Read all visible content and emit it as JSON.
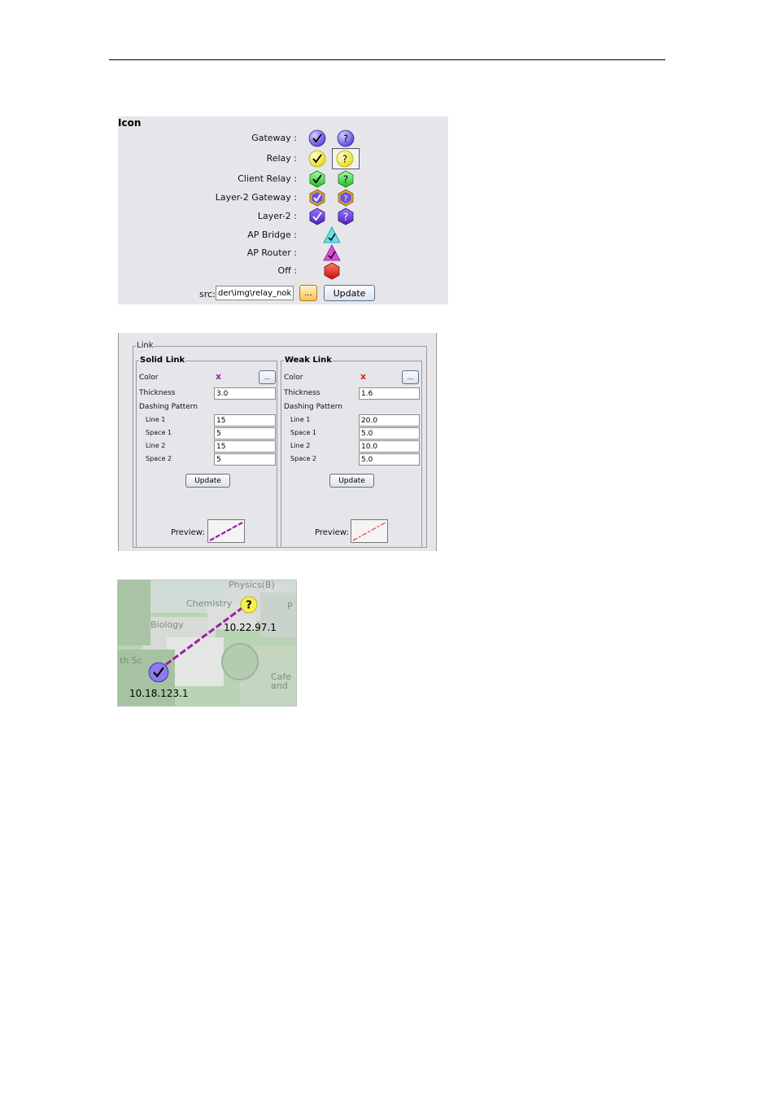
{
  "icon_panel": {
    "title": "Icon",
    "rows": [
      {
        "label": "Gateway :"
      },
      {
        "label": "Relay :"
      },
      {
        "label": "Client Relay :"
      },
      {
        "label": "Layer-2 Gateway :"
      },
      {
        "label": "Layer-2 :"
      },
      {
        "label": "AP Bridge :"
      },
      {
        "label": "AP Router :"
      },
      {
        "label": "Off :"
      }
    ],
    "src_label": "src:",
    "src_value": "der\\img\\relay_nok.gif",
    "browse_label": "...",
    "update_label": "Update"
  },
  "link_panel": {
    "title": "Link",
    "solid": {
      "title": "Solid Link",
      "color_label": "Color",
      "color_mark": "x",
      "color_value": "#9b1fa5",
      "browse_label": "...",
      "thickness_label": "Thickness",
      "thickness": "3.0",
      "dashing_label": "Dashing Pattern",
      "line1_label": "Line 1",
      "line1": "15",
      "space1_label": "Space 1",
      "space1": "5",
      "line2_label": "Line 2",
      "line2": "15",
      "space2_label": "Space 2",
      "space2": "5",
      "update_label": "Update",
      "preview_label": "Preview:"
    },
    "weak": {
      "title": "Weak Link",
      "color_label": "Color",
      "color_mark": "x",
      "color_value": "#e0201a",
      "browse_label": "...",
      "thickness_label": "Thickness",
      "thickness": "1.6",
      "dashing_label": "Dashing Pattern",
      "line1_label": "Line 1",
      "line1": "20.0",
      "space1_label": "Space 1",
      "space1": "5.0",
      "line2_label": "Line 2",
      "line2": "10.0",
      "space2_label": "Space 2",
      "space2": "5.0",
      "update_label": "Update",
      "preview_label": "Preview:"
    }
  },
  "map": {
    "labels": {
      "physics": "Physics(B)",
      "chemistry": "Chemistry",
      "biology": "Biology",
      "science": "th Sc",
      "cafe1": "Cafe",
      "cafe2": "and",
      "p": "P"
    },
    "relay_ip": "10.22.97.1",
    "gateway_ip": "10.18.123.1"
  },
  "colors": {
    "gateway": "#7b68ee",
    "relay": "#f5f04a",
    "client_relay": "#4cd94c",
    "layer2": "#6a2fd6",
    "ap_bridge": "#66e0e8",
    "ap_router": "#d94cd9",
    "off": "#e82020"
  }
}
